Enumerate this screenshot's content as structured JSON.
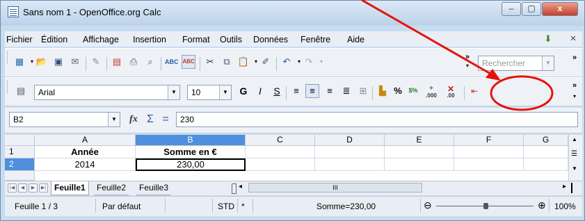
{
  "window": {
    "title": "Sans nom 1 - OpenOffice.org Calc",
    "minimize": "–",
    "maximize": "▢",
    "close": "x"
  },
  "menu": {
    "items": [
      "Fichier",
      "Édition",
      "Affichage",
      "Insertion",
      "Format",
      "Outils",
      "Données",
      "Fenêtre",
      "Aide"
    ],
    "close_doc": "×"
  },
  "toolbar": {
    "search_placeholder": "Rechercher",
    "overflow": "»"
  },
  "format_toolbar": {
    "font_name": "Arial",
    "font_size": "10",
    "bold": "G",
    "italic": "I",
    "underline": "S",
    "percent": "%",
    "currency": "$%",
    "add_decimal": ".000",
    "remove_decimal": ".00"
  },
  "formula_bar": {
    "name_box": "B2",
    "fx": "fx",
    "sum": "Σ",
    "equals": "=",
    "content": "230"
  },
  "sheet": {
    "columns": [
      "A",
      "B",
      "C",
      "D",
      "E",
      "F",
      "G"
    ],
    "rows": [
      {
        "num": "1",
        "cells": [
          "Année",
          "Somme en €"
        ]
      },
      {
        "num": "2",
        "cells": [
          "2014",
          "230,00"
        ]
      }
    ],
    "selected_cell": "B2"
  },
  "tabs": {
    "items": [
      "Feuille1",
      "Feuille2",
      "Feuille3"
    ],
    "active": "Feuille1",
    "hscroll_mark": "III"
  },
  "status": {
    "sheet": "Feuille 1 / 3",
    "style": "Par défaut",
    "mode": "STD",
    "modified": "*",
    "sum": "Somme=230,00",
    "zoom": "100%"
  },
  "annotation": {
    "arrow_color": "#e8100a",
    "circle_color": "#e8100a"
  }
}
